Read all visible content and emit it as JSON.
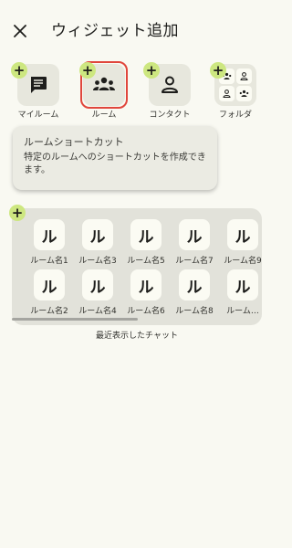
{
  "header": {
    "title": "ウィジェット追加",
    "close_icon": "close-icon"
  },
  "widgets": [
    {
      "label": "マイルーム",
      "icon": "chat-icon"
    },
    {
      "label": "ルーム",
      "icon": "group-icon",
      "selected": true
    },
    {
      "label": "コンタクト",
      "icon": "person-icon"
    },
    {
      "label": "フォルダ",
      "icon": "folder-grid-icon"
    }
  ],
  "tooltip": {
    "title": "ルームショートカット",
    "description": "特定のルームへのショートカットを作成できます。"
  },
  "preview": {
    "rooms": [
      {
        "initial": "ル",
        "name": "ルーム名1"
      },
      {
        "initial": "ル",
        "name": "ルーム名2"
      },
      {
        "initial": "ル",
        "name": "ルーム名3"
      },
      {
        "initial": "ル",
        "name": "ルーム名4"
      },
      {
        "initial": "ル",
        "name": "ルーム名5"
      },
      {
        "initial": "ル",
        "name": "ルーム名6"
      },
      {
        "initial": "ル",
        "name": "ルーム名7"
      },
      {
        "initial": "ル",
        "name": "ルーム名8"
      },
      {
        "initial": "ル",
        "name": "ルーム名9"
      },
      {
        "initial": "ル",
        "name": "ルーム…"
      }
    ],
    "caption": "最近表示したチャット"
  },
  "colors": {
    "background": "#f9f9f2",
    "tile": "#e7e7dd",
    "badge": "#cde780",
    "selection": "#e0463c",
    "preview": "#e2e2da"
  }
}
